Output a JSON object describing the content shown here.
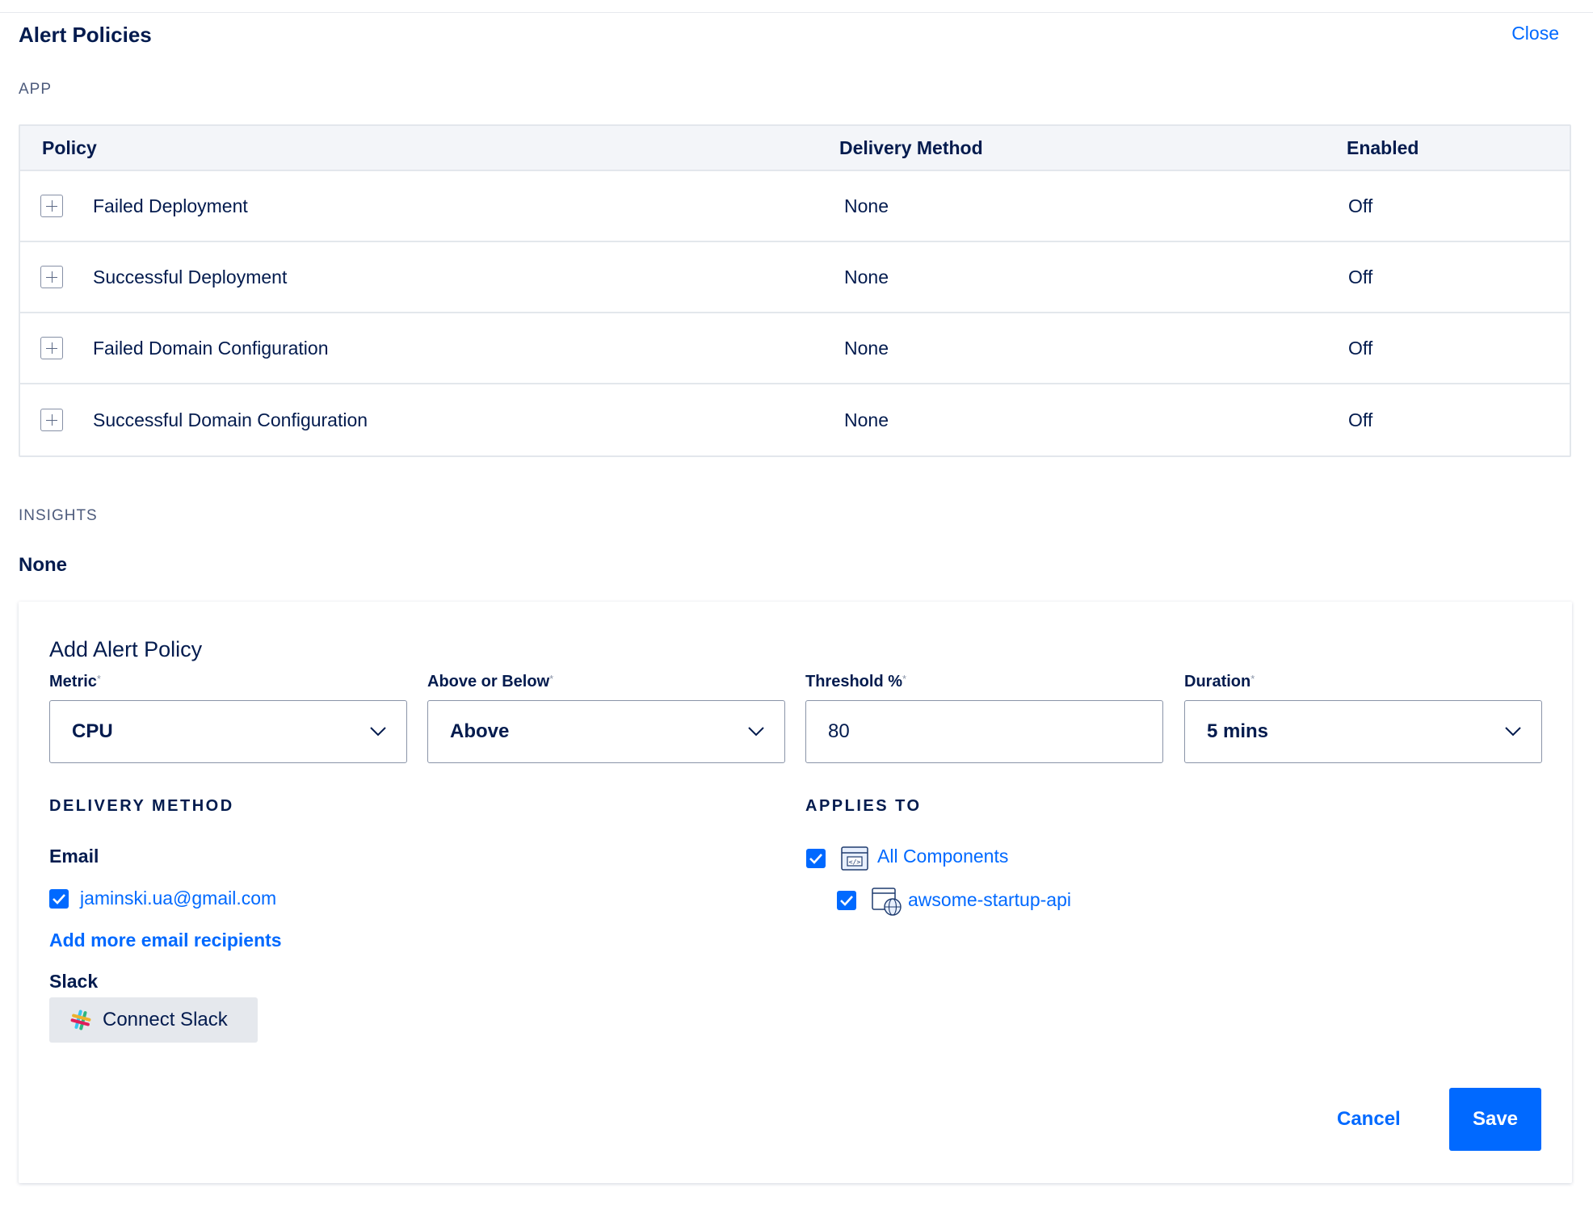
{
  "header": {
    "title": "Alert Policies",
    "close_label": "Close"
  },
  "sections": {
    "app_label": "APP",
    "insights_label": "INSIGHTS",
    "insights_value": "None"
  },
  "policy_table": {
    "columns": [
      "Policy",
      "Delivery Method",
      "Enabled"
    ],
    "rows": [
      {
        "policy": "Failed Deployment",
        "delivery": "None",
        "enabled": "Off"
      },
      {
        "policy": "Successful Deployment",
        "delivery": "None",
        "enabled": "Off"
      },
      {
        "policy": "Failed Domain Configuration",
        "delivery": "None",
        "enabled": "Off"
      },
      {
        "policy": "Successful Domain Configuration",
        "delivery": "None",
        "enabled": "Off"
      }
    ]
  },
  "add_policy": {
    "title": "Add Alert Policy",
    "required_marker": "*",
    "metric": {
      "label": "Metric",
      "value": "CPU"
    },
    "above_below": {
      "label": "Above or Below",
      "value": "Above"
    },
    "threshold": {
      "label": "Threshold %",
      "value": "80"
    },
    "duration": {
      "label": "Duration",
      "value": "5 mins"
    },
    "delivery_heading": "DELIVERY METHOD",
    "email_label": "Email",
    "email_recipient": "jaminski.ua@gmail.com",
    "email_checked": true,
    "add_email_label": "Add more email recipients",
    "slack_label": "Slack",
    "connect_slack_label": "Connect Slack",
    "applies_heading": "APPLIES TO",
    "components": [
      {
        "label": "All Components",
        "checked": true,
        "icon": "code-window-icon"
      },
      {
        "label": "awsome-startup-api",
        "checked": true,
        "icon": "web-service-icon"
      }
    ],
    "cancel_label": "Cancel",
    "save_label": "Save"
  },
  "colors": {
    "accent": "#0069ff",
    "text": "#031b4e",
    "muted": "#4d5b7c",
    "border": "#e3e7ec"
  }
}
